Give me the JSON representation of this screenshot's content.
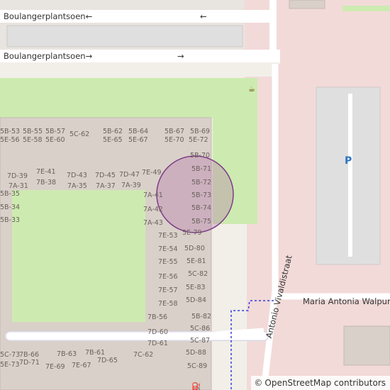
{
  "map": {
    "colors": {
      "background": "#f2efe9",
      "grass": "#cdebb0",
      "building": "#d9d0c9",
      "residential": "#e0dfdf",
      "commercial": "#f2dad9",
      "road": "#ffffff",
      "path_blue": "#2d3bdc",
      "circle_fill": "#b06ea8",
      "circle_stroke": "#7d3c86",
      "parking_blue": "#2e74c4"
    },
    "streets": {
      "top_street": "Boulangerplantsoen",
      "arrow_left": "←",
      "second_street": "Boulangerplantsoen",
      "arrow_right": "→",
      "maria": "Maria Antonia Walpurgi",
      "antonio": "Antonio Vivaldistraat"
    },
    "parking_label": "P",
    "poi_icons": [
      "cafe-icon",
      "fuel-icon"
    ],
    "house_numbers": [
      "5B-53",
      "5B-55",
      "5B-57",
      "5B-62",
      "5B-64",
      "5B-67",
      "5B-69",
      "5E-56",
      "5E-58",
      "5E-60",
      "5C-62",
      "5E-65",
      "5E-67",
      "5E-70",
      "5E-72",
      "5B-70",
      "5B-71",
      "5B-72",
      "5B-73",
      "5B-74",
      "5B-75",
      "7D-39",
      "7E-41",
      "7D-43",
      "7D-45",
      "7D-47",
      "7E-49",
      "7A-31",
      "7B-38",
      "7A-35",
      "7A-37",
      "7A-39",
      "7A-41",
      "7A-42",
      "7A-43",
      "5B-35",
      "5B-34",
      "5B-33",
      "7E-53",
      "5E-79",
      "7E-54",
      "5D-80",
      "7E-55",
      "5E-81",
      "7E-56",
      "5C-82",
      "7E-57",
      "5E-83",
      "7E-58",
      "5D-84",
      "7B-56",
      "5B-82",
      "7D-60",
      "5C-86",
      "7D-61",
      "5C-87",
      "7C-62",
      "5D-88",
      "5C-89",
      "5C-73",
      "7B-66",
      "7B-63",
      "7B-61",
      "5E-73",
      "7D-71",
      "7E-69",
      "7E-67",
      "7D-65"
    ],
    "attribution": {
      "symbol": "©",
      "text": "OpenStreetMap contributors"
    }
  }
}
